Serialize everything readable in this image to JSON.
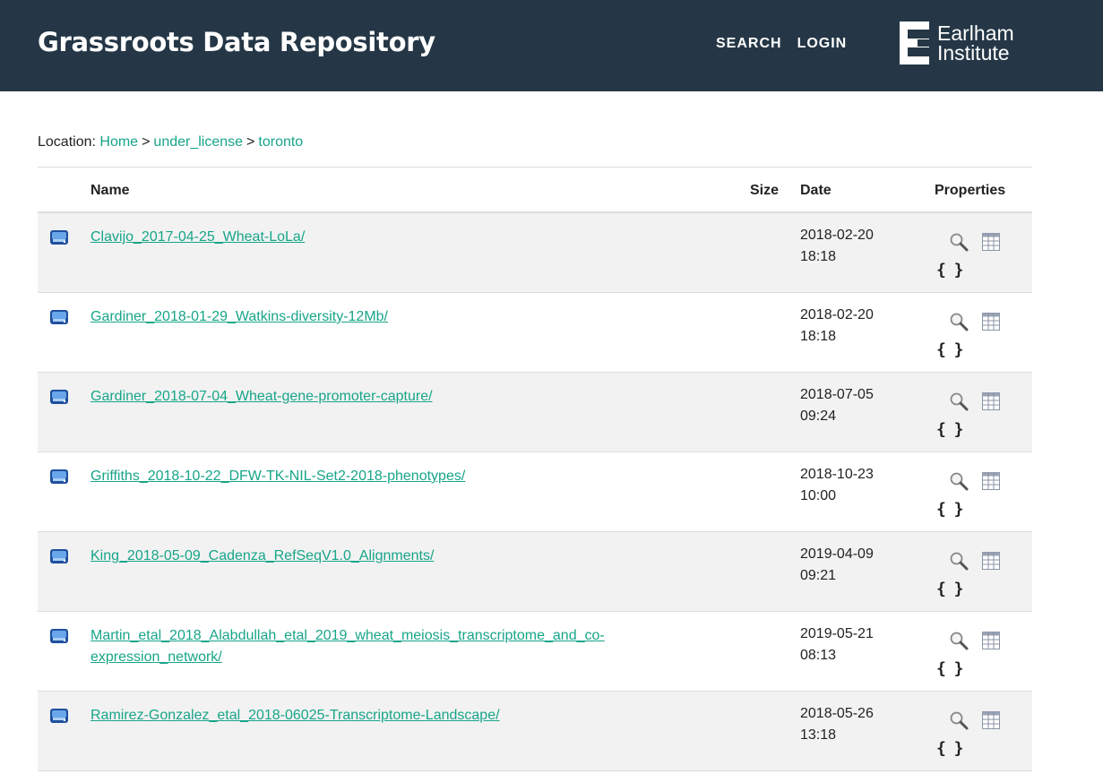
{
  "header": {
    "title": "Grassroots Data Repository",
    "nav": [
      "SEARCH",
      "LOGIN"
    ],
    "logo_line1": "Earlham",
    "logo_line2": "Institute"
  },
  "location": {
    "label": "Location:",
    "crumbs": [
      "Home",
      "under_license",
      "toronto"
    ],
    "separator": ">"
  },
  "table": {
    "columns": {
      "name": "Name",
      "size": "Size",
      "date": "Date",
      "properties": "Properties"
    },
    "rows": [
      {
        "name": "Clavijo_2017-04-25_Wheat-LoLa/",
        "size": "",
        "date": "2018-02-20",
        "time": "18:18"
      },
      {
        "name": "Gardiner_2018-01-29_Watkins-diversity-12Mb/",
        "size": "",
        "date": "2018-02-20",
        "time": "18:18"
      },
      {
        "name": "Gardiner_2018-07-04_Wheat-gene-promoter-capture/",
        "size": "",
        "date": "2018-07-05",
        "time": "09:24"
      },
      {
        "name": "Griffiths_2018-10-22_DFW-TK-NIL-Set2-2018-phenotypes/",
        "size": "",
        "date": "2018-10-23",
        "time": "10:00"
      },
      {
        "name": "King_2018-05-09_Cadenza_RefSeqV1.0_Alignments/",
        "size": "",
        "date": "2019-04-09",
        "time": "09:21"
      },
      {
        "name": "Martin_etal_2018_Alabdullah_etal_2019_wheat_meiosis_transcriptome_and_co-expression_network/",
        "size": "",
        "date": "2019-05-21",
        "time": "08:13"
      },
      {
        "name": "Ramirez-Gonzalez_etal_2018-06025-Transcriptome-Landscape/",
        "size": "",
        "date": "2018-05-26",
        "time": "13:18"
      }
    ],
    "json_glyph": "{ }"
  },
  "colors": {
    "header_bg": "#253746",
    "link": "#17a589",
    "row_alt": "#f2f2f2"
  },
  "icons": {
    "folder": "drive-icon",
    "search": "magnifier-icon",
    "grid": "table-icon",
    "json": "json-braces-icon"
  }
}
